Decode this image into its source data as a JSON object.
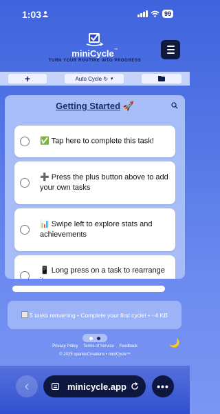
{
  "status_bar": {
    "time": "1:03",
    "battery": "99"
  },
  "header": {
    "brand": "miniCycle",
    "tm": "™",
    "tagline": "TURN YOUR ROUTINE INTO PROGRESS"
  },
  "toolbar": {
    "add_label": "+",
    "mode_label": "Auto Cycle ↻",
    "mode_caret": "▾"
  },
  "list": {
    "title": "Getting Started",
    "title_emoji": "🚀",
    "tasks": [
      {
        "icon": "✅",
        "text": "Tap here to complete this task!"
      },
      {
        "icon": "➕",
        "text": "Press the plus button above to add your own tasks"
      },
      {
        "icon": "📊",
        "text": "Swipe left to explore stats and achievements"
      },
      {
        "icon": "📱",
        "text": "Long press on a task to rearrange it"
      }
    ]
  },
  "status_message": "5 tasks remaining • Complete your first cycle! • ~4 KB",
  "pager": {
    "active_index": 0,
    "count": 2
  },
  "footer": {
    "links": [
      "Privacy Policy",
      "Terms of Service",
      "Feedback"
    ],
    "copyright": "© 2025 sparkinCreations • miniCycle™"
  },
  "browser": {
    "url": "minicycle.app",
    "back_symbol": "‹",
    "more_symbol": "•••"
  },
  "colors": {
    "background_top": "#3f63dd",
    "background_bottom": "#7a96f2",
    "card_bg": "#a7bdf7",
    "menu_button_bg": "#0f1a3e",
    "title_color": "#1c2a6b",
    "pager_active": "#ffffff",
    "pager_inactive": "#1c2a6b"
  }
}
